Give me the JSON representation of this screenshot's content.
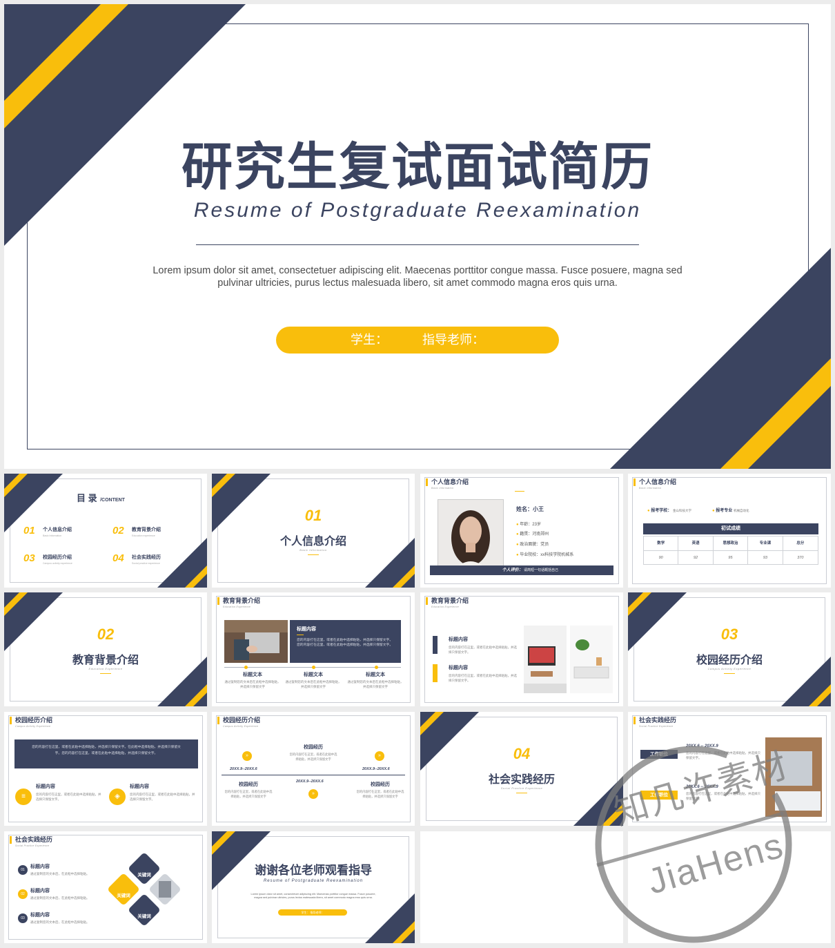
{
  "cover": {
    "title": "研究生复试面试简历",
    "subtitle": "Resume of Postgraduate Reexamination",
    "body": "Lorem ipsum dolor sit amet, consectetuer adipiscing elit. Maecenas porttitor congue massa. Fusce posuere, magna sed pulvinar ultricies, purus lectus malesuada libero, sit amet commodo magna eros quis urna.",
    "student_label": "学生：",
    "teacher_label": "指导老师：",
    "colors": {
      "navy": "#3b4460",
      "yellow": "#f9be0c"
    }
  },
  "toc": {
    "title": "目 录",
    "title_en": "/CONTENT",
    "items": [
      {
        "num": "01",
        "label": "个人信息介绍",
        "sub": "Basic Information"
      },
      {
        "num": "02",
        "label": "教育背景介绍",
        "sub": "Education experience"
      },
      {
        "num": "03",
        "label": "校园经历介绍",
        "sub": "Campus activity experience"
      },
      {
        "num": "04",
        "label": "社会实践经历",
        "sub": "Social practice experience"
      }
    ]
  },
  "section1": {
    "num": "01",
    "label": "个人信息介绍",
    "sub": "Basic Information"
  },
  "section2": {
    "num": "02",
    "label": "教育背景介绍",
    "sub": "Education Experience"
  },
  "section3": {
    "num": "03",
    "label": "校园经历介绍",
    "sub": "Campus Activity Experience"
  },
  "section4": {
    "num": "04",
    "label": "社会实践经历",
    "sub": "Social Practice Experience"
  },
  "profile": {
    "header": "个人信息介绍",
    "header_sub": "Basic Information",
    "name": "姓名：小王",
    "fields": [
      "年龄：23岁",
      "籍贯：河南郑州",
      "政治面貌：党员",
      "毕业院校：xx科技学院机械系"
    ],
    "eval_label": "个人评价：",
    "eval_text": "请简短一句话概括自己"
  },
  "scores": {
    "header": "个人信息介绍",
    "header_sub": "Basic Information",
    "school_label": "报考学校：",
    "school": "金山科技大学",
    "major_label": "报考专业",
    "major": "机械自动化",
    "table_title": "初试成绩",
    "columns": [
      "数学",
      "英语",
      "思想政治",
      "专业课",
      "总分"
    ],
    "values": [
      "90",
      "92",
      "95",
      "93",
      "370"
    ]
  },
  "edu1": {
    "header": "教育背景介绍",
    "header_sub": "Education Experience",
    "box_title": "标题内容",
    "box_text": "您的内容打在这里，或者在此粘中选择粘贴，并选择只保留文字。您的内容打在这里，或者在此粘中选择粘贴，并选择只保留文字。",
    "cols": [
      {
        "title": "标题文本",
        "text": "通过复制您的文本后在此框中选择粘贴，并选择只保留文字"
      },
      {
        "title": "标题文本",
        "text": "通过复制您的文本后在此框中选择粘贴，并选择只保留文字"
      },
      {
        "title": "标题文本",
        "text": "通过复制您的文本后在此框中选择粘贴，并选择只保留文字"
      }
    ]
  },
  "edu2": {
    "header": "教育背景介绍",
    "header_sub": "Education Experience",
    "items": [
      {
        "title": "标题内容",
        "text": "您的内容打在这里，或者在此粘中选择粘贴，并选择只保留文字。"
      },
      {
        "title": "标题内容",
        "text": "您的内容打在这里，或者在此粘中选择粘贴，并选择只保留文字。"
      }
    ]
  },
  "campus1": {
    "header": "校园经历介绍",
    "header_sub": "Campus Activity Experience",
    "banner": "您的内容打在这里，或者在此粘中选择粘贴，并选择只保留文字。在此框中选择粘贴，并选择只保留文字。您的内容打在这里，或者在此粘中选择粘贴，并选择只保留文字。",
    "items": [
      {
        "title": "标题内容",
        "text": "您的内容打在这里，或者在此粘中选择粘贴，并选择只保留文字。"
      },
      {
        "title": "标题内容",
        "text": "您的内容打在这里，或者在此粘中选择粘贴，并选择只保留文字。"
      }
    ]
  },
  "campus2": {
    "header": "校园经历介绍",
    "header_sub": "Campus Activity Experience",
    "date_left": "20XX.9--20XX.6",
    "date_mid": "20XX.9--20XX.6",
    "date_right": "20XX.9--20XX.6",
    "title": "校园经历",
    "text": "您的内容打在这里，或者在此粘中选择粘贴，并选择只保留文字"
  },
  "social1": {
    "header": "社会实践经历",
    "header_sub": "Social Practice Experience",
    "role": "工作职位",
    "date": "20XX.6 -- 20XX.9",
    "text": "您的内容打在这里，或者在此粘中选择粘贴，并选择只保留文字。"
  },
  "social2": {
    "header": "社会实践经历",
    "header_sub": "Social Practice Experience",
    "items": [
      {
        "num": "01",
        "title": "标题内容",
        "text": "通过复制您的文本后，在此框中选择粘贴。"
      },
      {
        "num": "02",
        "title": "标题内容",
        "text": "通过复制您的文本后，在此框中选择粘贴。"
      },
      {
        "num": "03",
        "title": "标题内容",
        "text": "通过复制您的文本后，在此框中选择粘贴。"
      }
    ],
    "keyword": "关键词"
  },
  "thanks": {
    "title": "谢谢各位老师观看指导",
    "subtitle": "Resume of Postgraduate Reexamination",
    "body": "Lorem ipsum dolor sit amet, consectetuer adipiscing elit. Maecenas porttitor congue massa. Fusce posuere, magna sed pulvinar ultricies, purus lectus malesuada libero, sit amet commodo magna eros quis urna.",
    "pill": "学生：  指导老师："
  },
  "watermark": {
    "cn": "知几许素材",
    "en": "JiaHens"
  }
}
